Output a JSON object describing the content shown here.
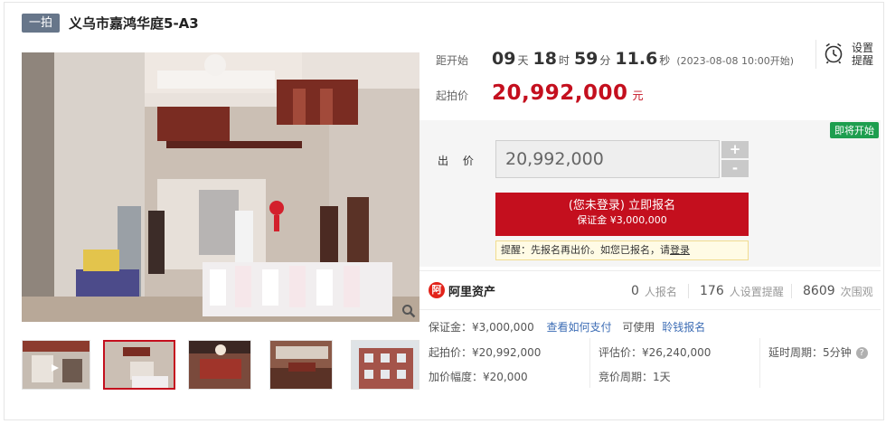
{
  "header": {
    "badge": "一拍",
    "title": "义乌市嘉鸿华庭5-A3"
  },
  "countdown": {
    "label": "距开始",
    "days": "09",
    "days_unit": "天",
    "hours": "18",
    "hours_unit": "时",
    "minutes": "59",
    "minutes_unit": "分",
    "seconds": "11.6",
    "seconds_unit": "秒",
    "start_text": "(2023-08-08 10:00开始)"
  },
  "reminder": {
    "label": "设置提醒",
    "icon": "alarm-clock-icon"
  },
  "starting_price": {
    "label": "起拍价",
    "value": "20,992,000",
    "unit": "元"
  },
  "bid": {
    "status": "即将开始",
    "label": "出 价",
    "input_value": "20,992,000",
    "plus": "+",
    "minus": "-",
    "signup_line1": "(您未登录) 立即报名",
    "signup_line2": "保证金 ¥3,000,000",
    "tip_prefix": "提醒：先报名再出价。如您已报名，请",
    "tip_link": "登录"
  },
  "brand": {
    "logo_char": "阿",
    "name": "阿里资产"
  },
  "stats": [
    {
      "num": "0",
      "text": "人报名"
    },
    {
      "num": "176",
      "text": "人设置提醒"
    },
    {
      "num": "8609",
      "text": "次围观"
    }
  ],
  "deposit": {
    "text": "保证金：¥3,000,000",
    "pay_link": "查看如何支付",
    "usable": "可使用",
    "alipay_link": "聆钱报名"
  },
  "details": {
    "starting": "起拍价：¥20,992,000",
    "increment": "加价幅度：¥20,000",
    "assessed": "评估价：¥26,240,000",
    "bid_cycle": "竞价周期：1天",
    "delay": "延时周期：5分钟",
    "help_icon": "?"
  },
  "gallery": {
    "zoom_icon": "magnifier-icon",
    "thumb_count": 5,
    "active_thumb": 2
  },
  "colors": {
    "accent_red": "#c40f1e",
    "status_green": "#1e9e4f",
    "link_blue": "#3d6db5"
  }
}
